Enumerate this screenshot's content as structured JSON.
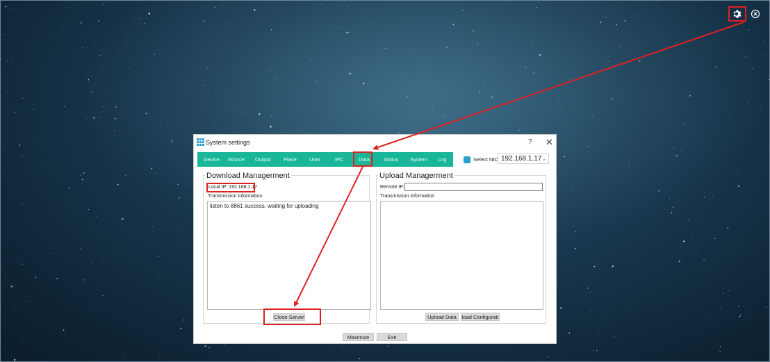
{
  "dialog": {
    "title": "System settings",
    "help": "?",
    "close": "✕",
    "tabs": [
      "Device",
      "Source",
      "Output",
      "Place",
      "User",
      "IPC",
      "Data",
      "Status",
      "System",
      "Log"
    ],
    "active_tab": "Data",
    "select_nic_label": "Select NIC",
    "nic_value": "192.168.1.17",
    "download": {
      "title": "Download Managerment",
      "local_ip": "Local IP: 192.168.1.17",
      "transmission_label": "Transmission Information",
      "log_text": "listen to 8861 success. waiting for uploading",
      "close_server": "Close Server"
    },
    "upload": {
      "title": "Upload Managerment",
      "remote_ip_label": "Remote IP:",
      "remote_ip_value": "",
      "transmission_label": "Transmission Information",
      "upload_data": "Upload Data",
      "load_config": "load Configurati"
    },
    "maximize": "Maximize",
    "exit": "Exit"
  },
  "colors": {
    "tab_bar": "#1ab699",
    "highlight": "#e02020",
    "nic_icon": "#2aa3c9"
  },
  "icons": {
    "settings": "gear-icon",
    "close_window": "close-circle-icon",
    "app": "grid-icon"
  }
}
